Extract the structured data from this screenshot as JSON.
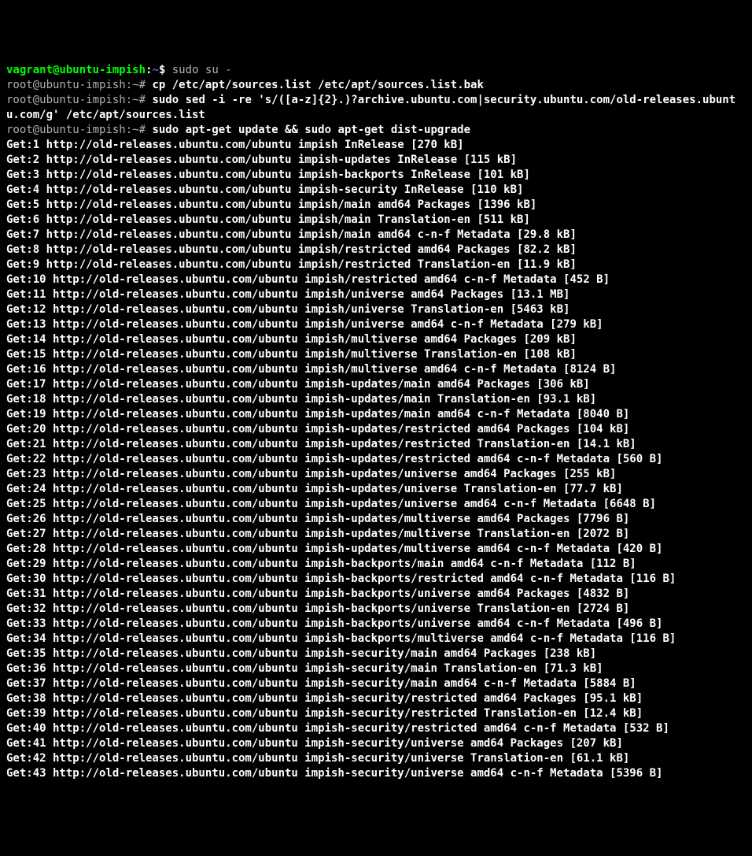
{
  "prompts": [
    {
      "user": "vagrant@ubuntu-impish",
      "userColor": "green-bold",
      "sep": ":",
      "path": "~",
      "prompt": "$",
      "cmd": "sudo su -"
    },
    {
      "user": "root@ubuntu-impish",
      "userColor": "gray",
      "sep": ":",
      "path": "~",
      "prompt": "#",
      "cmd": "cp /etc/apt/sources.list /etc/apt/sources.list.bak"
    },
    {
      "user": "root@ubuntu-impish",
      "userColor": "gray",
      "sep": ":",
      "path": "~",
      "prompt": "#",
      "cmd": "sudo sed -i -re 's/([a-z]{2}.)?archive.ubuntu.com|security.ubuntu.com/old-releases.ubuntu.com/g' /etc/apt/sources.list"
    },
    {
      "user": "root@ubuntu-impish",
      "userColor": "gray",
      "sep": ":",
      "path": "~",
      "prompt": "#",
      "cmd": "sudo apt-get update && sudo apt-get dist-upgrade"
    }
  ],
  "output": [
    "Get:1 http://old-releases.ubuntu.com/ubuntu impish InRelease [270 kB]",
    "Get:2 http://old-releases.ubuntu.com/ubuntu impish-updates InRelease [115 kB]",
    "Get:3 http://old-releases.ubuntu.com/ubuntu impish-backports InRelease [101 kB]",
    "Get:4 http://old-releases.ubuntu.com/ubuntu impish-security InRelease [110 kB]",
    "Get:5 http://old-releases.ubuntu.com/ubuntu impish/main amd64 Packages [1396 kB]",
    "Get:6 http://old-releases.ubuntu.com/ubuntu impish/main Translation-en [511 kB]",
    "Get:7 http://old-releases.ubuntu.com/ubuntu impish/main amd64 c-n-f Metadata [29.8 kB]",
    "Get:8 http://old-releases.ubuntu.com/ubuntu impish/restricted amd64 Packages [82.2 kB]",
    "Get:9 http://old-releases.ubuntu.com/ubuntu impish/restricted Translation-en [11.9 kB]",
    "Get:10 http://old-releases.ubuntu.com/ubuntu impish/restricted amd64 c-n-f Metadata [452 B]",
    "Get:11 http://old-releases.ubuntu.com/ubuntu impish/universe amd64 Packages [13.1 MB]",
    "Get:12 http://old-releases.ubuntu.com/ubuntu impish/universe Translation-en [5463 kB]",
    "Get:13 http://old-releases.ubuntu.com/ubuntu impish/universe amd64 c-n-f Metadata [279 kB]",
    "Get:14 http://old-releases.ubuntu.com/ubuntu impish/multiverse amd64 Packages [209 kB]",
    "Get:15 http://old-releases.ubuntu.com/ubuntu impish/multiverse Translation-en [108 kB]",
    "Get:16 http://old-releases.ubuntu.com/ubuntu impish/multiverse amd64 c-n-f Metadata [8124 B]",
    "Get:17 http://old-releases.ubuntu.com/ubuntu impish-updates/main amd64 Packages [306 kB]",
    "Get:18 http://old-releases.ubuntu.com/ubuntu impish-updates/main Translation-en [93.1 kB]",
    "Get:19 http://old-releases.ubuntu.com/ubuntu impish-updates/main amd64 c-n-f Metadata [8040 B]",
    "Get:20 http://old-releases.ubuntu.com/ubuntu impish-updates/restricted amd64 Packages [104 kB]",
    "Get:21 http://old-releases.ubuntu.com/ubuntu impish-updates/restricted Translation-en [14.1 kB]",
    "Get:22 http://old-releases.ubuntu.com/ubuntu impish-updates/restricted amd64 c-n-f Metadata [560 B]",
    "Get:23 http://old-releases.ubuntu.com/ubuntu impish-updates/universe amd64 Packages [255 kB]",
    "Get:24 http://old-releases.ubuntu.com/ubuntu impish-updates/universe Translation-en [77.7 kB]",
    "Get:25 http://old-releases.ubuntu.com/ubuntu impish-updates/universe amd64 c-n-f Metadata [6648 B]",
    "Get:26 http://old-releases.ubuntu.com/ubuntu impish-updates/multiverse amd64 Packages [7796 B]",
    "Get:27 http://old-releases.ubuntu.com/ubuntu impish-updates/multiverse Translation-en [2072 B]",
    "Get:28 http://old-releases.ubuntu.com/ubuntu impish-updates/multiverse amd64 c-n-f Metadata [420 B]",
    "Get:29 http://old-releases.ubuntu.com/ubuntu impish-backports/main amd64 c-n-f Metadata [112 B]",
    "Get:30 http://old-releases.ubuntu.com/ubuntu impish-backports/restricted amd64 c-n-f Metadata [116 B]",
    "Get:31 http://old-releases.ubuntu.com/ubuntu impish-backports/universe amd64 Packages [4832 B]",
    "Get:32 http://old-releases.ubuntu.com/ubuntu impish-backports/universe Translation-en [2724 B]",
    "Get:33 http://old-releases.ubuntu.com/ubuntu impish-backports/universe amd64 c-n-f Metadata [496 B]",
    "Get:34 http://old-releases.ubuntu.com/ubuntu impish-backports/multiverse amd64 c-n-f Metadata [116 B]",
    "Get:35 http://old-releases.ubuntu.com/ubuntu impish-security/main amd64 Packages [238 kB]",
    "Get:36 http://old-releases.ubuntu.com/ubuntu impish-security/main Translation-en [71.3 kB]",
    "Get:37 http://old-releases.ubuntu.com/ubuntu impish-security/main amd64 c-n-f Metadata [5884 B]",
    "Get:38 http://old-releases.ubuntu.com/ubuntu impish-security/restricted amd64 Packages [95.1 kB]",
    "Get:39 http://old-releases.ubuntu.com/ubuntu impish-security/restricted Translation-en [12.4 kB]",
    "Get:40 http://old-releases.ubuntu.com/ubuntu impish-security/restricted amd64 c-n-f Metadata [532 B]",
    "Get:41 http://old-releases.ubuntu.com/ubuntu impish-security/universe amd64 Packages [207 kB]",
    "Get:42 http://old-releases.ubuntu.com/ubuntu impish-security/universe Translation-en [61.1 kB]",
    "Get:43 http://old-releases.ubuntu.com/ubuntu impish-security/universe amd64 c-n-f Metadata [5396 B]"
  ]
}
